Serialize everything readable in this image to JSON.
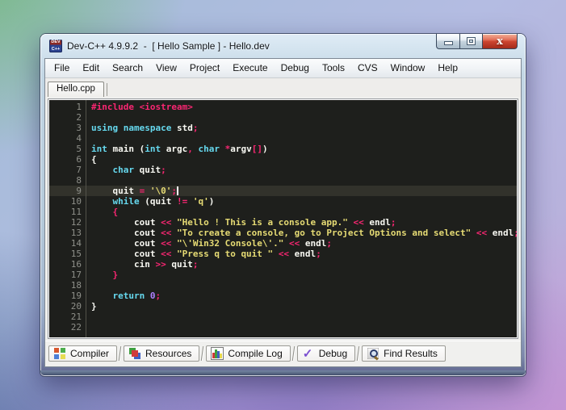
{
  "window": {
    "title": "Dev-C++ 4.9.9.2  -  [ Hello Sample ] - Hello.dev",
    "app_icon": "devcpp-icon",
    "controls": [
      "minimize-icon",
      "maximize-icon",
      "close-icon"
    ],
    "close_button_color": "#cd4530"
  },
  "menu": {
    "items": [
      "File",
      "Edit",
      "Search",
      "View",
      "Project",
      "Execute",
      "Debug",
      "Tools",
      "CVS",
      "Window",
      "Help"
    ]
  },
  "editor": {
    "tab": "Hello.cpp",
    "cursor_line": "9",
    "highlight_line": "9",
    "colors": {
      "background": "#1e1f1c",
      "highlight": "#32322b",
      "gutter_text": "#8f908a",
      "keyword": "#66d9ef",
      "operator": "#f92672",
      "string": "#e6db74",
      "number": "#ae81ff",
      "plain": "#f8f8f2",
      "preprocessor": "#f92672"
    },
    "lines": [
      {
        "num": "1",
        "tokens": [
          [
            "pre",
            "#include <iostream>"
          ]
        ]
      },
      {
        "num": "2",
        "tokens": []
      },
      {
        "num": "3",
        "tokens": [
          [
            "kw",
            "using"
          ],
          [
            "pl",
            " "
          ],
          [
            "kw",
            "namespace"
          ],
          [
            "pl",
            " std"
          ],
          [
            "op",
            ";"
          ]
        ]
      },
      {
        "num": "4",
        "tokens": []
      },
      {
        "num": "5",
        "tokens": [
          [
            "kw",
            "int"
          ],
          [
            "pl",
            " main ("
          ],
          [
            "kw",
            "int"
          ],
          [
            "pl",
            " argc"
          ],
          [
            "op",
            ","
          ],
          [
            "pl",
            " "
          ],
          [
            "kw",
            "char"
          ],
          [
            "pl",
            " "
          ],
          [
            "op",
            "*"
          ],
          [
            "pl",
            "argv"
          ],
          [
            "op",
            "[]"
          ],
          [
            "pl",
            ")"
          ]
        ]
      },
      {
        "num": "6",
        "tokens": [
          [
            "pl",
            "{"
          ]
        ]
      },
      {
        "num": "7",
        "tokens": [
          [
            "pl",
            "    "
          ],
          [
            "kw",
            "char"
          ],
          [
            "pl",
            " quit"
          ],
          [
            "op",
            ";"
          ]
        ]
      },
      {
        "num": "8",
        "tokens": []
      },
      {
        "num": "9",
        "tokens": [
          [
            "pl",
            "    quit "
          ],
          [
            "op",
            "="
          ],
          [
            "pl",
            " "
          ],
          [
            "str",
            "'\\0'"
          ],
          [
            "op",
            ";"
          ]
        ]
      },
      {
        "num": "10",
        "tokens": [
          [
            "pl",
            "    "
          ],
          [
            "kw",
            "while"
          ],
          [
            "pl",
            " (quit "
          ],
          [
            "op",
            "!="
          ],
          [
            "pl",
            " "
          ],
          [
            "str",
            "'q'"
          ],
          [
            "pl",
            ")"
          ]
        ]
      },
      {
        "num": "11",
        "tokens": [
          [
            "pl",
            "    "
          ],
          [
            "op",
            "{"
          ]
        ]
      },
      {
        "num": "12",
        "tokens": [
          [
            "pl",
            "        cout "
          ],
          [
            "op",
            "<<"
          ],
          [
            "pl",
            " "
          ],
          [
            "str",
            "\"Hello ! This is a console app.\""
          ],
          [
            "pl",
            " "
          ],
          [
            "op",
            "<<"
          ],
          [
            "pl",
            " endl"
          ],
          [
            "op",
            ";"
          ]
        ]
      },
      {
        "num": "13",
        "tokens": [
          [
            "pl",
            "        cout "
          ],
          [
            "op",
            "<<"
          ],
          [
            "pl",
            " "
          ],
          [
            "str",
            "\"To create a console, go to Project Options and select\""
          ],
          [
            "pl",
            " "
          ],
          [
            "op",
            "<<"
          ],
          [
            "pl",
            " endl"
          ],
          [
            "op",
            ";"
          ]
        ]
      },
      {
        "num": "14",
        "tokens": [
          [
            "pl",
            "        cout "
          ],
          [
            "op",
            "<<"
          ],
          [
            "pl",
            " "
          ],
          [
            "str",
            "\"\\'Win32 Console\\'.\""
          ],
          [
            "pl",
            " "
          ],
          [
            "op",
            "<<"
          ],
          [
            "pl",
            " endl"
          ],
          [
            "op",
            ";"
          ]
        ]
      },
      {
        "num": "15",
        "tokens": [
          [
            "pl",
            "        cout "
          ],
          [
            "op",
            "<<"
          ],
          [
            "pl",
            " "
          ],
          [
            "str",
            "\"Press q to quit \""
          ],
          [
            "pl",
            " "
          ],
          [
            "op",
            "<<"
          ],
          [
            "pl",
            " endl"
          ],
          [
            "op",
            ";"
          ]
        ]
      },
      {
        "num": "16",
        "tokens": [
          [
            "pl",
            "        cin "
          ],
          [
            "op",
            ">>"
          ],
          [
            "pl",
            " quit"
          ],
          [
            "op",
            ";"
          ]
        ]
      },
      {
        "num": "17",
        "tokens": [
          [
            "pl",
            "    "
          ],
          [
            "op",
            "}"
          ]
        ]
      },
      {
        "num": "18",
        "tokens": []
      },
      {
        "num": "19",
        "tokens": [
          [
            "pl",
            "    "
          ],
          [
            "kw",
            "return"
          ],
          [
            "pl",
            " "
          ],
          [
            "num",
            "0"
          ],
          [
            "op",
            ";"
          ]
        ]
      },
      {
        "num": "20",
        "tokens": [
          [
            "pl",
            "}"
          ]
        ]
      },
      {
        "num": "21",
        "tokens": []
      },
      {
        "num": "22",
        "tokens": []
      }
    ]
  },
  "bottom_tabs": {
    "items": [
      {
        "label": "Compiler",
        "icon": "compiler-icon"
      },
      {
        "label": "Resources",
        "icon": "resources-icon"
      },
      {
        "label": "Compile Log",
        "icon": "compile-log-icon"
      },
      {
        "label": "Debug",
        "icon": "debug-icon"
      },
      {
        "label": "Find Results",
        "icon": "find-results-icon"
      }
    ]
  }
}
